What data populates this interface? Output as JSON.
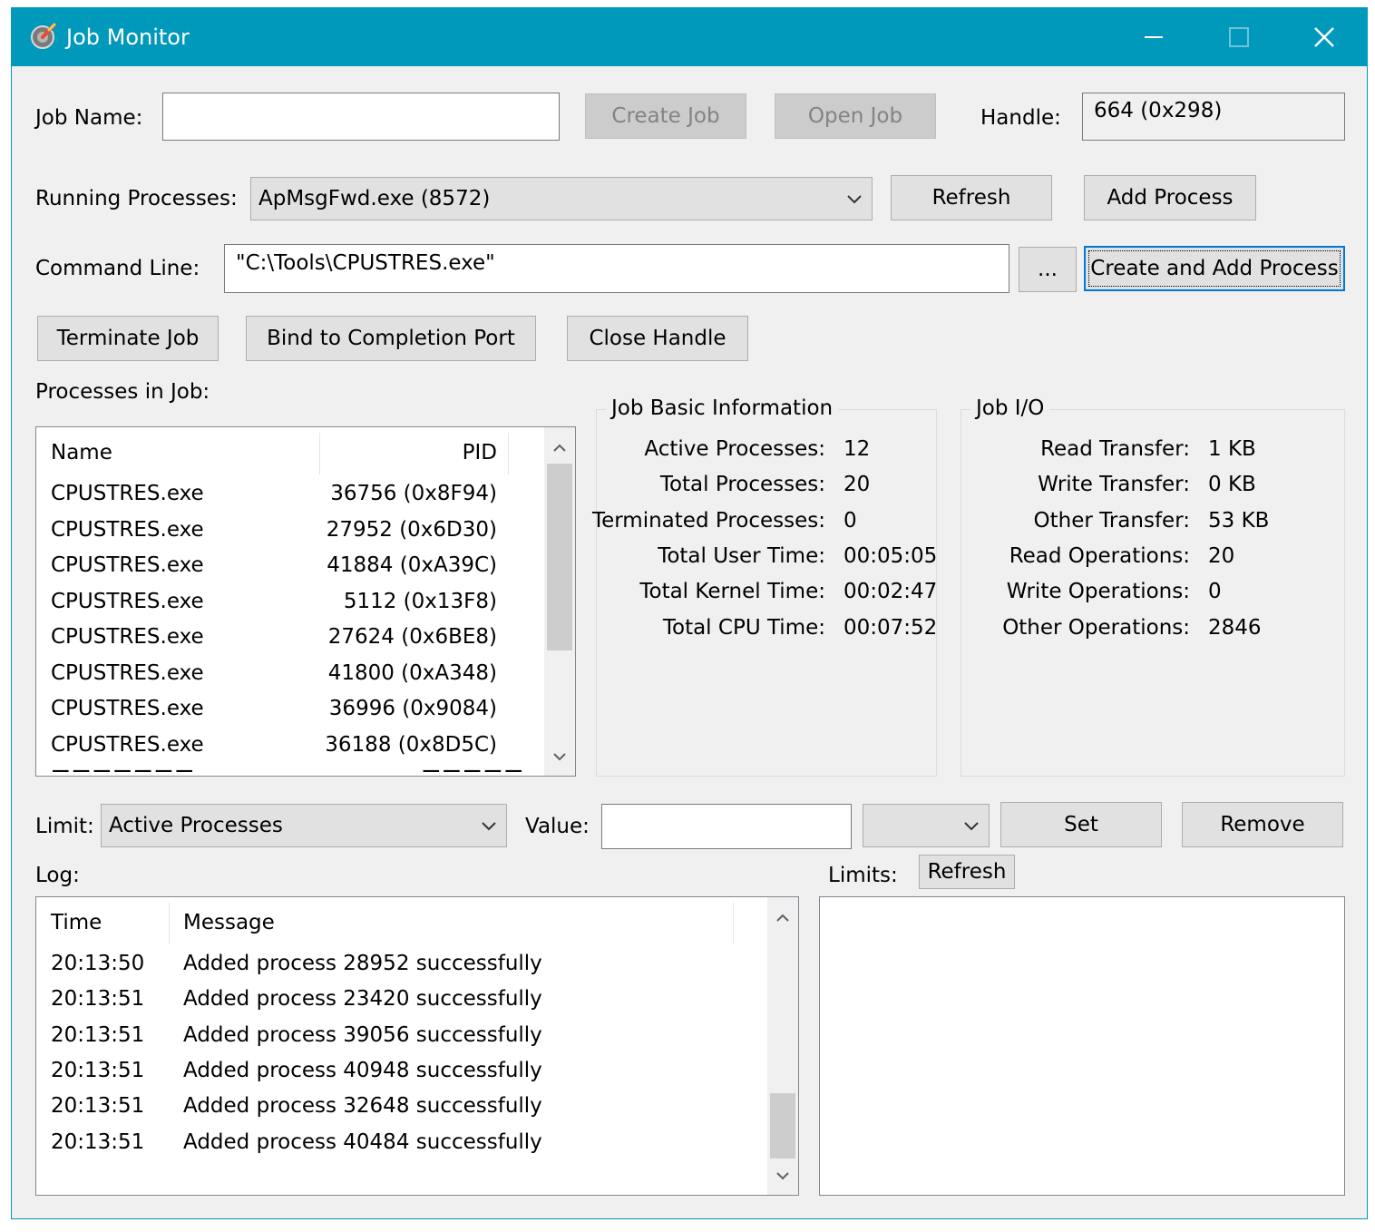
{
  "window": {
    "title": "Job Monitor",
    "accent": "#0099bc",
    "controls": {
      "minimize": "minimize-icon",
      "maximize": "maximize-icon",
      "close": "close-icon"
    }
  },
  "job": {
    "name_label": "Job Name:",
    "name_value": "",
    "create_label": "Create Job",
    "open_label": "Open Job",
    "handle_label": "Handle:",
    "handle_value": "664 (0x298)"
  },
  "processes": {
    "label": "Running Processes:",
    "selected": "ApMsgFwd.exe (8572)",
    "refresh_label": "Refresh",
    "add_label": "Add Process"
  },
  "command": {
    "label": "Command Line:",
    "value": "\"C:\\Tools\\CPUSTRES.exe\"",
    "browse_label": "...",
    "create_add_label": "Create and Add Process"
  },
  "actions": {
    "terminate_label": "Terminate Job",
    "bind_label": "Bind to Completion Port",
    "close_label": "Close Handle"
  },
  "job_processes": {
    "label": "Processes in Job:",
    "columns": {
      "name": "Name",
      "pid": "PID"
    },
    "rows": [
      {
        "name": "CPUSTRES.exe",
        "pid": "36756 (0x8F94)"
      },
      {
        "name": "CPUSTRES.exe",
        "pid": "27952 (0x6D30)"
      },
      {
        "name": "CPUSTRES.exe",
        "pid": "41884 (0xA39C)"
      },
      {
        "name": "CPUSTRES.exe",
        "pid": "5112 (0x13F8)"
      },
      {
        "name": "CPUSTRES.exe",
        "pid": "27624 (0x6BE8)"
      },
      {
        "name": "CPUSTRES.exe",
        "pid": "41800 (0xA348)"
      },
      {
        "name": "CPUSTRES.exe",
        "pid": "36996 (0x9084)"
      },
      {
        "name": "CPUSTRES.exe",
        "pid": "36188 (0x8D5C)"
      }
    ]
  },
  "basic_info": {
    "title": "Job Basic Information",
    "items": [
      {
        "label": "Active Processes:",
        "value": "12"
      },
      {
        "label": "Total Processes:",
        "value": "20"
      },
      {
        "label": "Terminated Processes:",
        "value": "0"
      },
      {
        "label": "Total User Time:",
        "value": "00:05:05"
      },
      {
        "label": "Total Kernel Time:",
        "value": "00:02:47"
      },
      {
        "label": "Total CPU Time:",
        "value": "00:07:52"
      }
    ]
  },
  "io_info": {
    "title": "Job I/O",
    "items": [
      {
        "label": "Read Transfer:",
        "value": "1 KB"
      },
      {
        "label": "Write Transfer:",
        "value": "0 KB"
      },
      {
        "label": "Other Transfer:",
        "value": "53 KB"
      },
      {
        "label": "Read Operations:",
        "value": "20"
      },
      {
        "label": "Write Operations:",
        "value": "0"
      },
      {
        "label": "Other Operations:",
        "value": "2846"
      }
    ]
  },
  "limit": {
    "label": "Limit:",
    "selected": "Active Processes",
    "value_label": "Value:",
    "value": "",
    "unit_selected": "",
    "set_label": "Set",
    "remove_label": "Remove"
  },
  "log": {
    "label": "Log:",
    "columns": {
      "time": "Time",
      "message": "Message"
    },
    "rows": [
      {
        "time": "20:13:50",
        "message": "Added process 28952 successfully"
      },
      {
        "time": "20:13:51",
        "message": "Added process 23420 successfully"
      },
      {
        "time": "20:13:51",
        "message": "Added process 39056 successfully"
      },
      {
        "time": "20:13:51",
        "message": "Added process 40948 successfully"
      },
      {
        "time": "20:13:51",
        "message": "Added process 32648 successfully"
      },
      {
        "time": "20:13:51",
        "message": "Added process 40484 successfully"
      }
    ]
  },
  "limits": {
    "label": "Limits:",
    "refresh_label": "Refresh"
  }
}
